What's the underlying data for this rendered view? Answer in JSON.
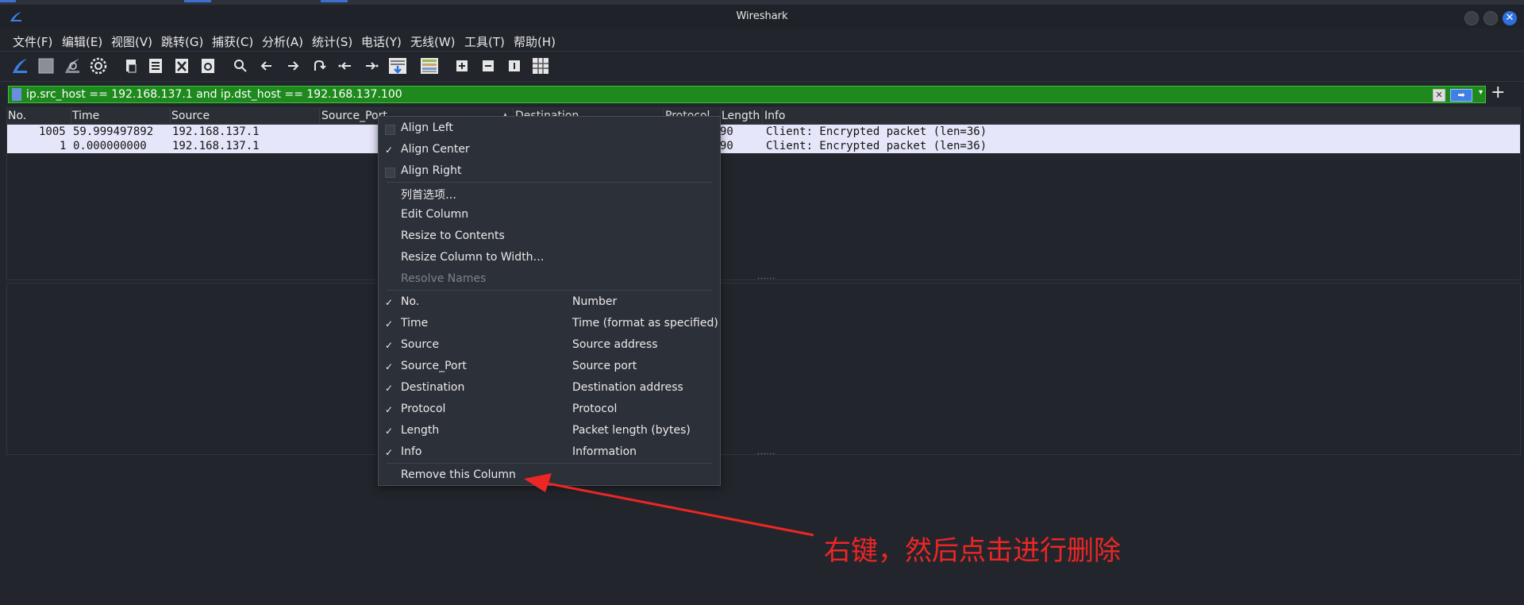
{
  "window": {
    "title": "Wireshark"
  },
  "menu": [
    "文件(F)",
    "编辑(E)",
    "视图(V)",
    "跳转(G)",
    "捕获(C)",
    "分析(A)",
    "统计(S)",
    "电话(Y)",
    "无线(W)",
    "工具(T)",
    "帮助(H)"
  ],
  "toolbar": {
    "icons": [
      "shark-fin-start-icon",
      "stop-square-icon",
      "restart-capture-icon",
      "capture-options-gear-icon",
      "open-file-icon",
      "save-file-icon",
      "close-file-icon",
      "reload-file-icon",
      "find-packet-icon",
      "go-back-icon",
      "go-forward-icon",
      "go-to-packet-icon",
      "first-packet-icon",
      "last-packet-icon",
      "auto-scroll-icon",
      "colorize-icon",
      "zoom-in-icon",
      "zoom-out-icon",
      "normal-size-icon",
      "resize-columns-icon"
    ]
  },
  "filter": {
    "text": "ip.src_host == 192.168.137.1 and ip.dst_host == 192.168.137.100",
    "clear_glyph": "✕",
    "apply_glyph": "➡",
    "dropdown_glyph": "▾",
    "add_glyph": "+",
    "bg_color": "#1e8a1e"
  },
  "packet_list": {
    "columns": [
      "No.",
      "Time",
      "Source",
      "Source_Port",
      "Destination",
      "Protocol",
      "Length",
      "Info"
    ],
    "sort_indicator": "▲",
    "rows": [
      {
        "no": "1005",
        "time": "59.999497892",
        "source": "192.168.137.1",
        "length": "90",
        "info": "Client: Encrypted packet (len=36)"
      },
      {
        "no": "1",
        "time": "0.000000000",
        "source": "192.168.137.1",
        "length": "90",
        "info": "Client: Encrypted packet (len=36)"
      }
    ],
    "row_bg": "#e6e6fa"
  },
  "context_menu": {
    "align": [
      {
        "label": "Align Left",
        "checked": false
      },
      {
        "label": "Align Center",
        "checked": true
      },
      {
        "label": "Align Right",
        "checked": false
      }
    ],
    "actions": [
      {
        "label": "列首选项…",
        "disabled": false
      },
      {
        "label": "Edit Column",
        "disabled": false
      },
      {
        "label": "Resize to Contents",
        "disabled": false
      },
      {
        "label": "Resize Column to Width…",
        "disabled": false
      },
      {
        "label": "Resolve Names",
        "disabled": true
      }
    ],
    "columns": [
      {
        "label": "No.",
        "desc": "Number",
        "checked": true
      },
      {
        "label": "Time",
        "desc": "Time (format as specified)",
        "checked": true
      },
      {
        "label": "Source",
        "desc": "Source address",
        "checked": true
      },
      {
        "label": "Source_Port",
        "desc": "Source port",
        "checked": true
      },
      {
        "label": "Destination",
        "desc": "Destination address",
        "checked": true
      },
      {
        "label": "Protocol",
        "desc": "Protocol",
        "checked": true
      },
      {
        "label": "Length",
        "desc": "Packet length (bytes)",
        "checked": true
      },
      {
        "label": "Info",
        "desc": "Information",
        "checked": true
      }
    ],
    "remove": "Remove this Column",
    "check_glyph": "✓"
  },
  "annotation": {
    "text": "右键，然后点击进行删除",
    "color": "#ee2525"
  },
  "grip": "......"
}
